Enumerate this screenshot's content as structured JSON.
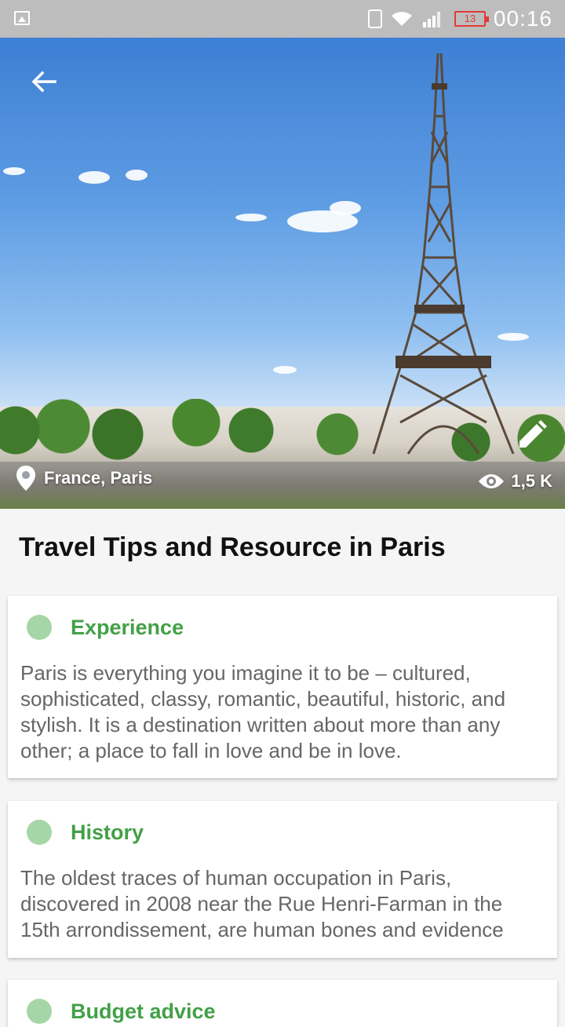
{
  "status_bar": {
    "battery": "13",
    "time": "00:16"
  },
  "hero": {
    "location": "France, Paris",
    "views": "1,5 K"
  },
  "page": {
    "title": "Travel Tips and Resource in Paris"
  },
  "cards": [
    {
      "title": "Experience",
      "body": "Paris is everything you imagine it to be – cultured, sophisticated, classy, romantic, beautiful, historic, and stylish. It is a destination written about more than any other; a place to fall in love and be in love."
    },
    {
      "title": "History",
      "body": "The oldest traces of human occupation in Paris, discovered in 2008 near the Rue Henri-Farman in the 15th arrondissement, are human bones and evidence"
    },
    {
      "title": "Budget advice",
      "body": ""
    }
  ],
  "colors": {
    "accent_green": "#43a047",
    "dot_green": "#a5d6a7",
    "status_bar": "#bdbdbd"
  }
}
